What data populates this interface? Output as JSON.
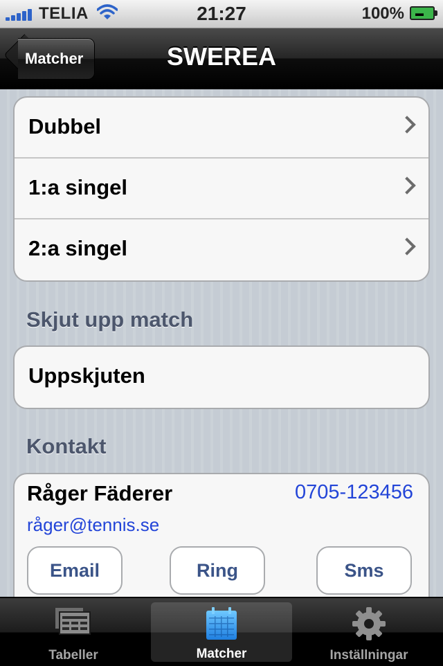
{
  "status_bar": {
    "carrier": "TELIA",
    "time": "21:27",
    "battery": "100%"
  },
  "nav": {
    "back_label": "Matcher",
    "title": "SWEREA"
  },
  "matches": [
    {
      "label": "Dubbel"
    },
    {
      "label": "1:a singel"
    },
    {
      "label": "2:a singel"
    }
  ],
  "postpone": {
    "header": "Skjut upp match",
    "row_label": "Uppskjuten"
  },
  "contact": {
    "header": "Kontakt",
    "name": "Råger Fäderer",
    "phone": "0705-123456",
    "email": "råger@tennis.se",
    "email_button": "Email",
    "call_button": "Ring",
    "sms_button": "Sms"
  },
  "tabbar": {
    "tabs": [
      {
        "label": "Tabeller",
        "icon": "tables-icon"
      },
      {
        "label": "Matcher",
        "icon": "calendar-icon",
        "active": true
      },
      {
        "label": "Inställningar",
        "icon": "gear-icon"
      }
    ]
  },
  "colors": {
    "link": "#2345d8",
    "section_header": "#4c566c",
    "button_text": "#3b5488"
  }
}
